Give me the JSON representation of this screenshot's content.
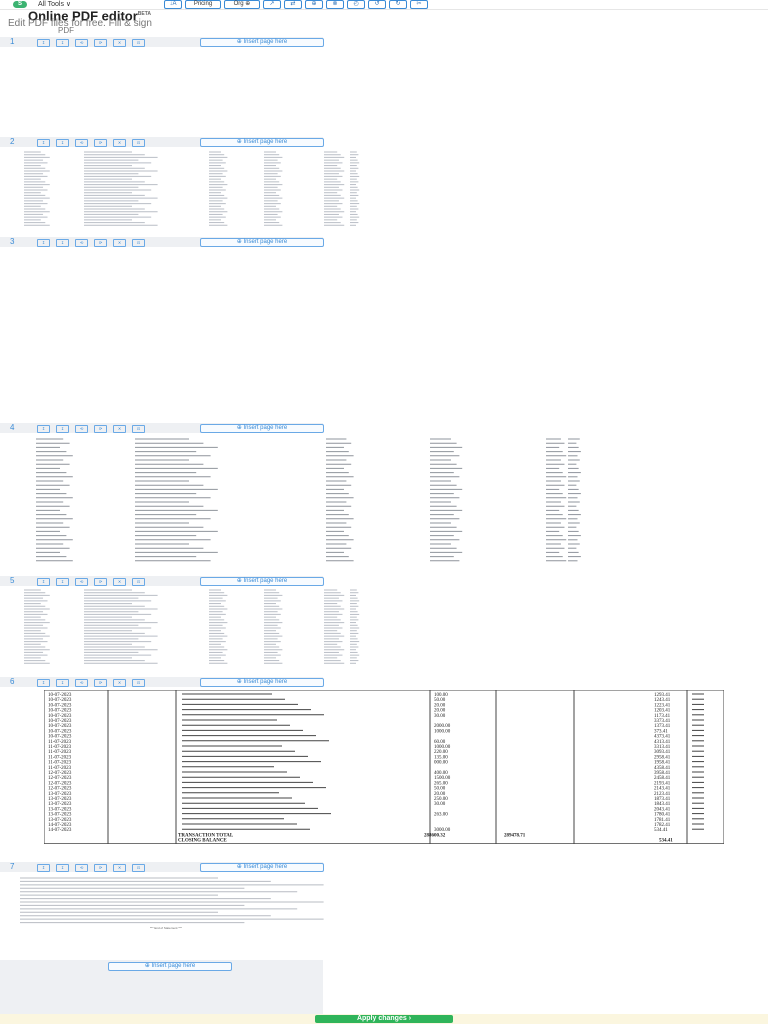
{
  "header": {
    "logo_text": "S",
    "all_tools": "All Tools ∨",
    "toolbar": [
      "↓A",
      "Pricing",
      "Org ⊕",
      "↗",
      "⇄",
      "⊕",
      "⊗",
      "◴",
      "↺",
      "↻",
      "✂"
    ],
    "title": "Online PDF editor",
    "title_badge": "BETA",
    "subtitle": "Edit PDF files for free. Fill & sign",
    "subtitle2": "PDF"
  },
  "pages": [
    {
      "number": "1",
      "insert_label": "⊕ Insert page here"
    },
    {
      "number": "2",
      "insert_label": "⊕ Insert page here"
    },
    {
      "number": "3",
      "insert_label": "⊕ Insert page here"
    },
    {
      "number": "4",
      "insert_label": "⊕ Insert page here"
    },
    {
      "number": "5",
      "insert_label": "⊕ Insert page here"
    },
    {
      "number": "6",
      "insert_label": "⊕ Insert page here"
    },
    {
      "number": "7",
      "insert_label": "⊕ Insert page here"
    }
  ],
  "page_tools": [
    "↥",
    "↧",
    "⟲",
    "⟳",
    "✕",
    "⊡"
  ],
  "statement_p6": {
    "rows": [
      {
        "date": "10-07-2023",
        "amount": "100.00",
        "balance": "1293.41"
      },
      {
        "date": "10-07-2023",
        "amount": "50.00",
        "balance": "1243.41"
      },
      {
        "date": "10-07-2023",
        "amount": "20.00",
        "balance": "1223.41"
      },
      {
        "date": "10-07-2023",
        "amount": "20.00",
        "balance": "1203.41"
      },
      {
        "date": "10-07-2023",
        "amount": "30.00",
        "balance": "1173.41"
      },
      {
        "date": "10-07-2023",
        "amount": "",
        "balance": "3373.41"
      },
      {
        "date": "10-07-2023",
        "amount": "2000.00",
        "balance": "1373.41"
      },
      {
        "date": "10-07-2023",
        "amount": "1000.00",
        "balance": "373.41"
      },
      {
        "date": "10-07-2023",
        "amount": "",
        "balance": "4373.41"
      },
      {
        "date": "11-07-2023",
        "amount": "60.00",
        "balance": "4313.41"
      },
      {
        "date": "11-07-2023",
        "amount": "1000.00",
        "balance": "3313.41"
      },
      {
        "date": "11-07-2023",
        "amount": "220.00",
        "balance": "3093.41"
      },
      {
        "date": "11-07-2023",
        "amount": "135.00",
        "balance": "2958.41"
      },
      {
        "date": "11-07-2023",
        "amount": "000.00",
        "balance": "1958.41"
      },
      {
        "date": "11-07-2023",
        "amount": "",
        "balance": "4358.41"
      },
      {
        "date": "12-07-2023",
        "amount": "400.00",
        "balance": "3958.41"
      },
      {
        "date": "12-07-2023",
        "amount": "1500.00",
        "balance": "2458.41"
      },
      {
        "date": "12-07-2023",
        "amount": "265.00",
        "balance": "2193.41"
      },
      {
        "date": "12-07-2023",
        "amount": "50.00",
        "balance": "2143.41"
      },
      {
        "date": "13-07-2023",
        "amount": "20.00",
        "balance": "2123.41"
      },
      {
        "date": "13-07-2023",
        "amount": "250.00",
        "balance": "1873.41"
      },
      {
        "date": "13-07-2023",
        "amount": "30.00",
        "balance": "1843.41"
      },
      {
        "date": "13-07-2023",
        "amount": "",
        "balance": "2043.41"
      },
      {
        "date": "13-07-2023",
        "amount": "263.00",
        "balance": "1780.41"
      },
      {
        "date": "13-07-2023",
        "amount": "",
        "balance": "1781.41"
      },
      {
        "date": "14-07-2023",
        "amount": "",
        "balance": "1782.41"
      },
      {
        "date": "14-07-2023",
        "amount": "3000.00",
        "balance": "534.41"
      }
    ],
    "totals_label": "TRANSACTION TOTAL",
    "total_debit": "288600.32",
    "total_credit": "289478.71",
    "closing_label": "CLOSING BALANCE",
    "closing_value": "534.41"
  },
  "footer_text": "*** End of Statement ***",
  "apply_button": "Apply changes ›"
}
